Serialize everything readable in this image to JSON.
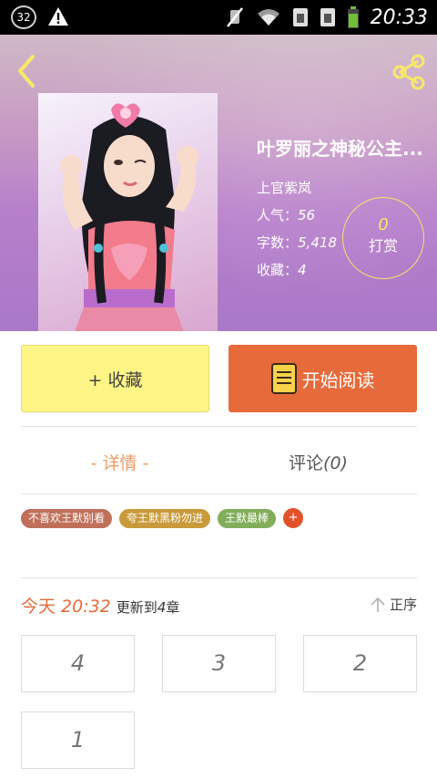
{
  "status_bar": {
    "notification_count": "32",
    "time": "20:33",
    "icons": [
      "warning-icon",
      "mute-icon",
      "wifi-icon",
      "sim1-icon",
      "sim2-icon",
      "battery-icon"
    ]
  },
  "header": {
    "back_icon": "chevron-left-icon",
    "share_icon": "share-icon"
  },
  "book": {
    "title": "叶罗丽之神秘公主...",
    "author": "上官紫岚",
    "popularity_label": "人气：",
    "popularity_value": "56",
    "words_label": "字数：",
    "words_value": "5,418",
    "favorites_label": "收藏：",
    "favorites_value": "4",
    "tip_count": "0",
    "tip_label": "打赏"
  },
  "actions": {
    "favorite_label": "+ 收藏",
    "read_label": "开始阅读"
  },
  "tabs": {
    "detail_label": "- 详情 -",
    "comments_label": "评论",
    "comments_count": "(0)"
  },
  "tags": [
    {
      "label": "不喜欢王默别看",
      "color": "#c0705a"
    },
    {
      "label": "夸王默黑粉勿进",
      "color": "#c99a3a"
    },
    {
      "label": "王默最棒",
      "color": "#82ad5a"
    }
  ],
  "tag_add_label": "+",
  "update": {
    "today": "今天",
    "time": "20:32",
    "prefix": "更新到",
    "count": "4",
    "suffix": "章",
    "sort_label": "正序"
  },
  "chapters": [
    "4",
    "3",
    "2",
    "1"
  ],
  "colors": {
    "accent_orange": "#e76a3a",
    "favorite_yellow": "#fef586",
    "tab_active": "#ee9a66"
  }
}
